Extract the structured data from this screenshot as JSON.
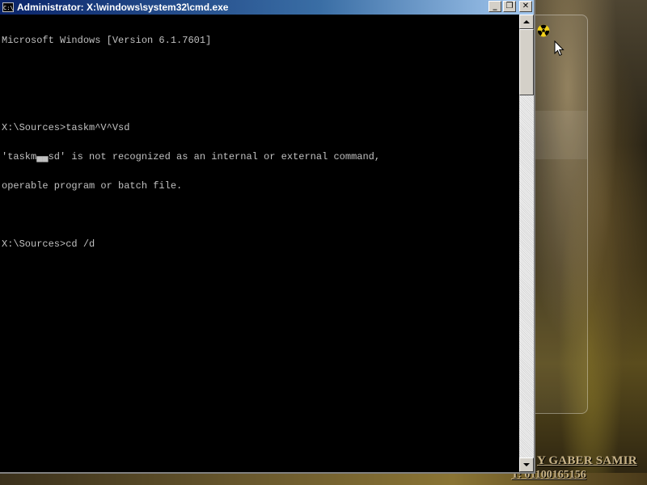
{
  "window": {
    "title": "Administrator: X:\\windows\\system32\\cmd.exe",
    "app_icon_label": "C:\\",
    "buttons": {
      "minimize": "_",
      "maximize": "❐",
      "close": "✕"
    }
  },
  "console": {
    "lines": [
      "Microsoft Windows [Version 6.1.7601]",
      "",
      "",
      "X:\\Sources>taskm^V^Vsd",
      "'taskm▄▄sd' is not recognized as an internal or external command,",
      "operable program or batch file.",
      "",
      "X:\\Sources>cd /d"
    ]
  },
  "desktop": {
    "watermark_line1": "Y GABER SAMIR",
    "watermark_line2": "T: 01100165156",
    "icons": {
      "radiation": "radiation-icon",
      "cursor": "mouse-pointer-icon"
    }
  },
  "colors": {
    "console_bg": "#000000",
    "console_fg": "#c0c0c0",
    "titlebar_start": "#0a246a",
    "titlebar_end": "#a6caf0"
  }
}
